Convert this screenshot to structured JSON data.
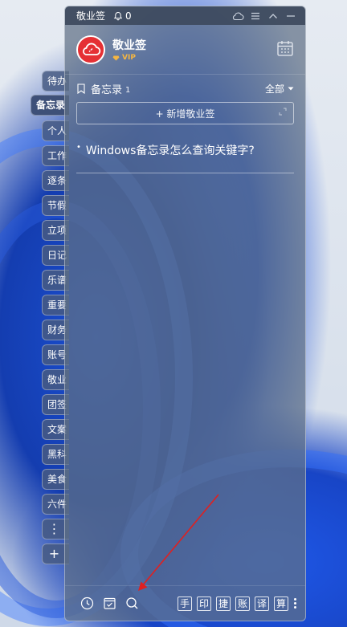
{
  "app": {
    "title": "敬业签",
    "reminder_count": "0"
  },
  "profile": {
    "name": "敬业签",
    "badge": "VIP"
  },
  "side_tabs": [
    {
      "label": "待办"
    },
    {
      "label": "备忘录",
      "active": true
    },
    {
      "label": "个人"
    },
    {
      "label": "工作"
    },
    {
      "label": "逐条"
    },
    {
      "label": "节假"
    },
    {
      "label": "立项"
    },
    {
      "label": "日记"
    },
    {
      "label": "乐谱"
    },
    {
      "label": "重要"
    },
    {
      "label": "财务"
    },
    {
      "label": "账号"
    },
    {
      "label": "敬业"
    },
    {
      "label": "团签"
    },
    {
      "label": "文案"
    },
    {
      "label": "黑科"
    },
    {
      "label": "美食"
    },
    {
      "label": "六件"
    }
  ],
  "section": {
    "title": "备忘录",
    "count": "1",
    "filter": "全部"
  },
  "new_note": {
    "label": "+ 新增敬业签"
  },
  "notes": [
    {
      "text": "Windows备忘录怎么查询关键字?"
    }
  ],
  "bottom_tools": [
    "手",
    "印",
    "捷",
    "账",
    "译",
    "算"
  ],
  "colors": {
    "accent_red": "#e53034",
    "vip_gold": "#f5b642",
    "annotation_arrow": "#e02020"
  }
}
